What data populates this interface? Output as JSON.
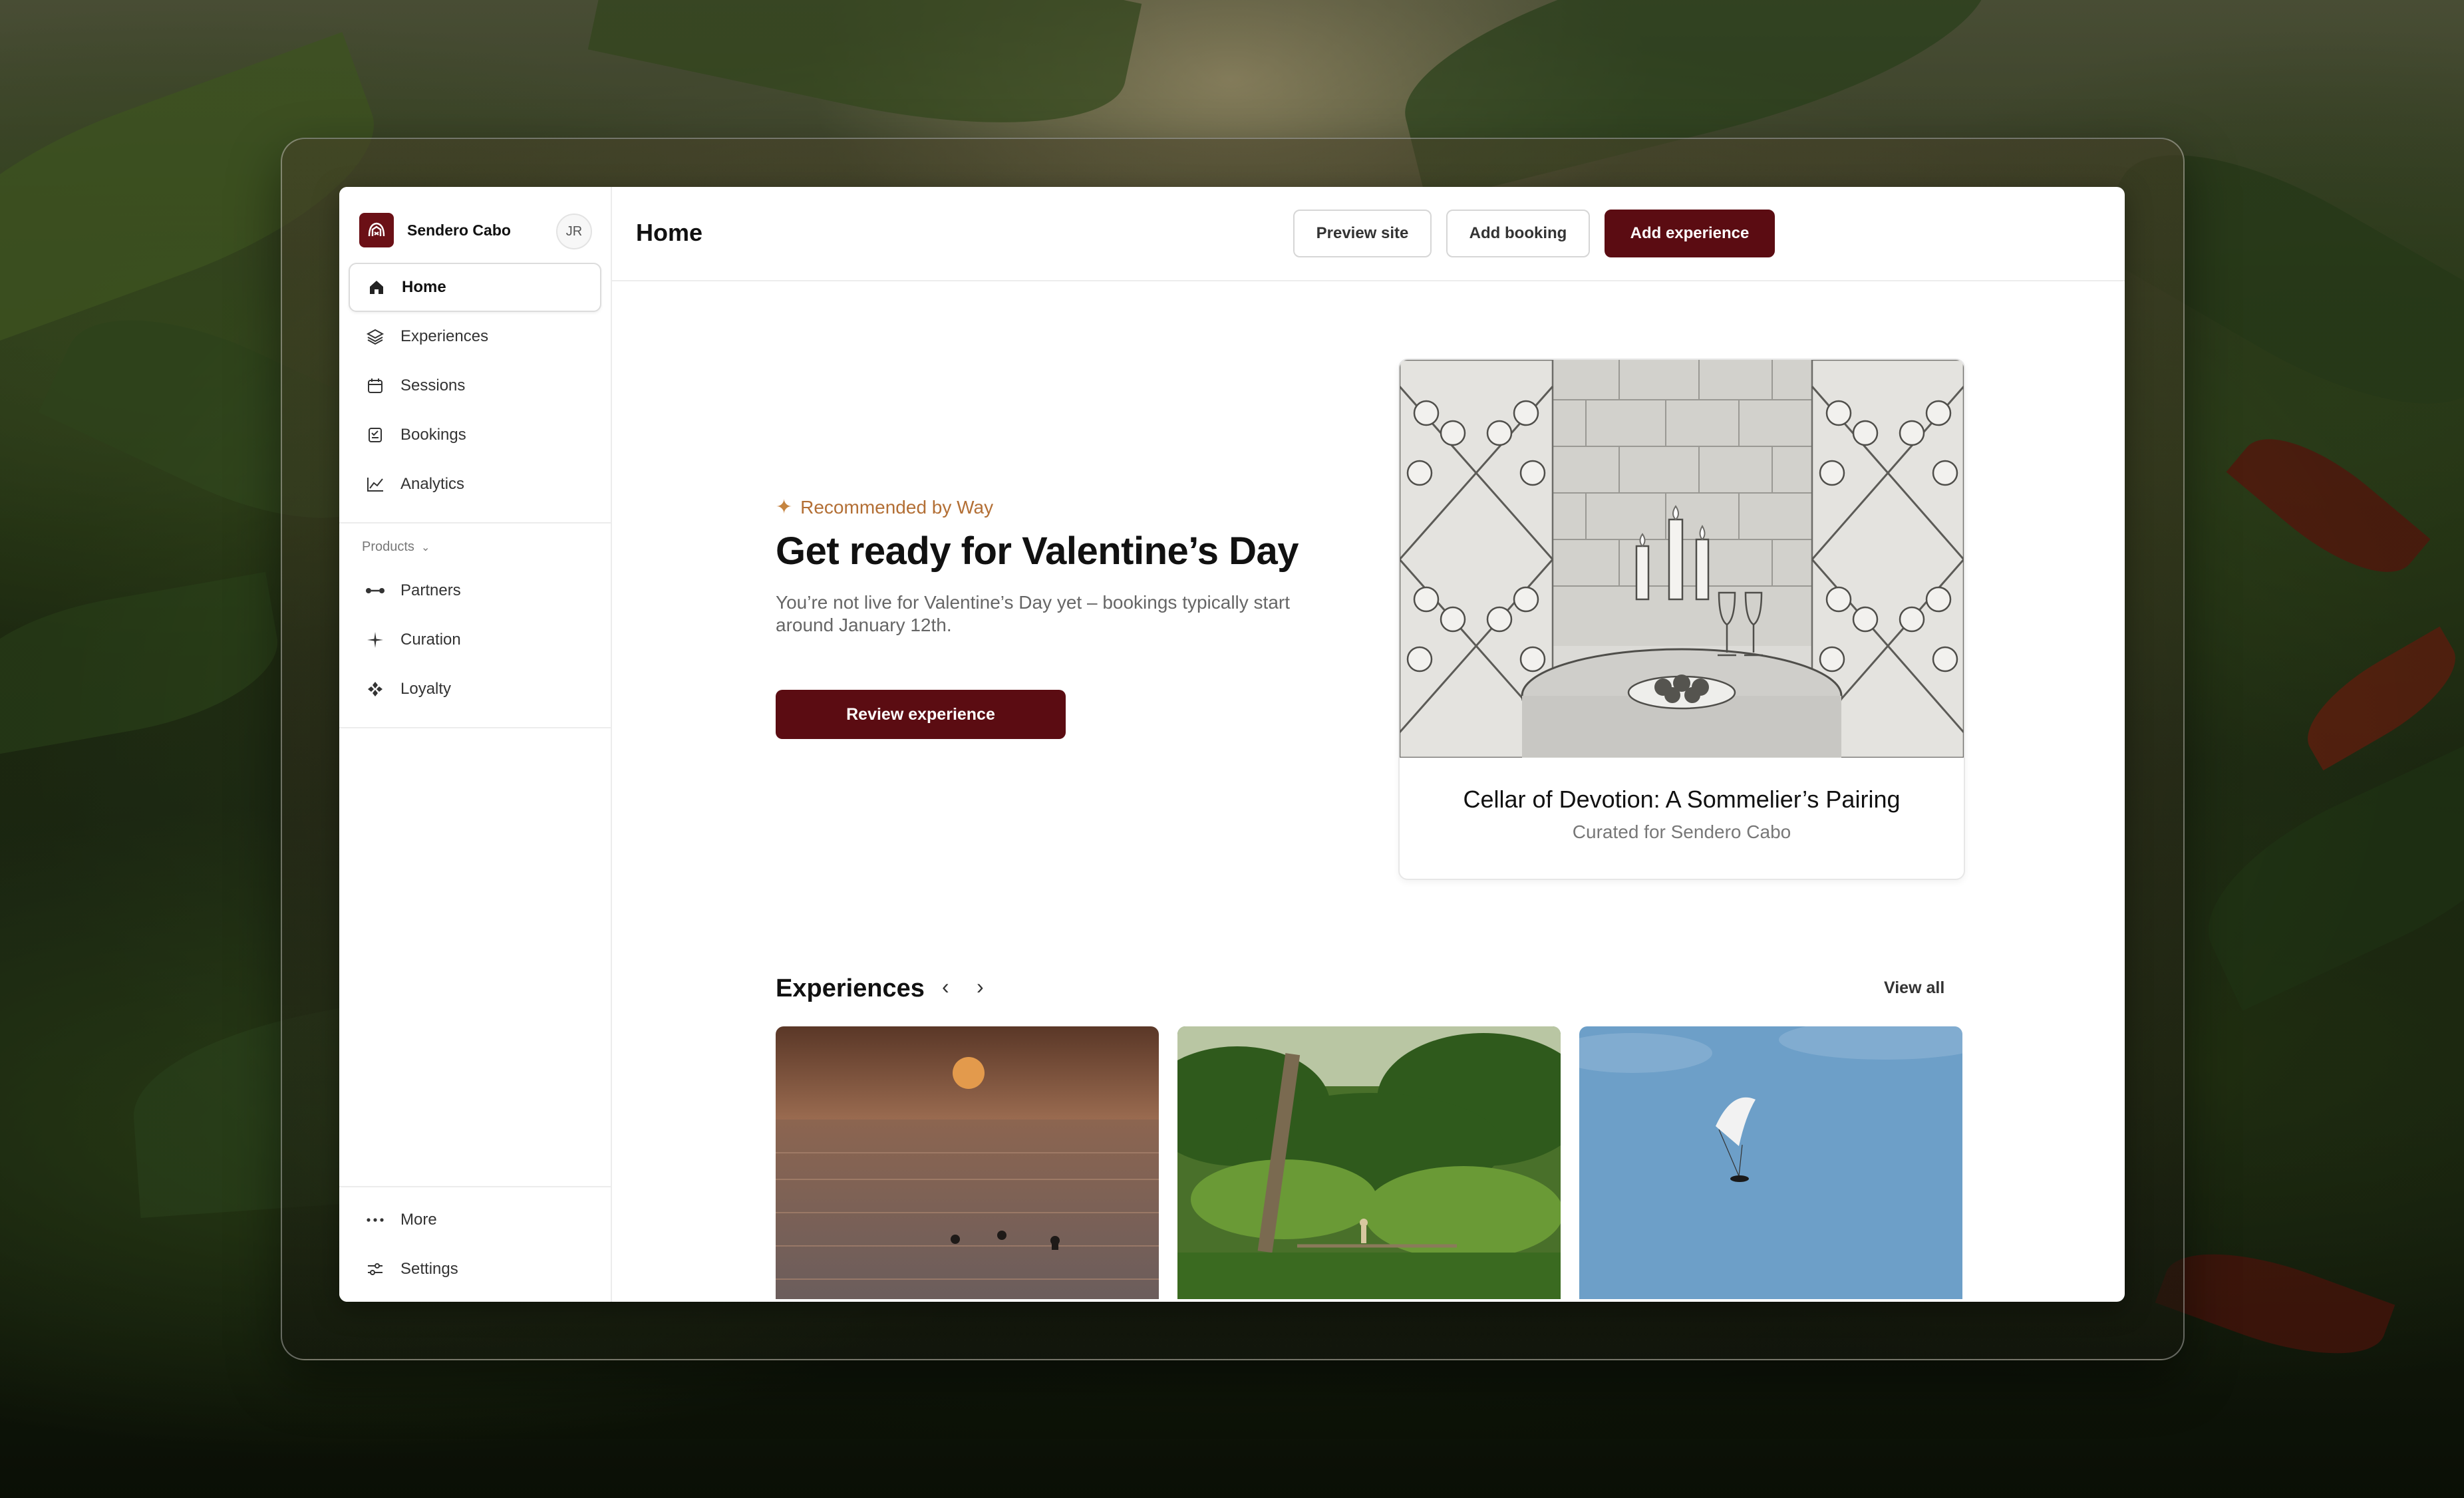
{
  "brand": {
    "name": "Sendero Cabo",
    "avatar_initials": "JR"
  },
  "sidebar": {
    "items": [
      {
        "label": "Home",
        "icon": "home-icon",
        "active": true
      },
      {
        "label": "Experiences",
        "icon": "layers-icon"
      },
      {
        "label": "Sessions",
        "icon": "calendar-icon"
      },
      {
        "label": "Bookings",
        "icon": "bookings-icon"
      },
      {
        "label": "Analytics",
        "icon": "chart-line-icon"
      }
    ],
    "section_label": "Products",
    "products": [
      {
        "label": "Partners",
        "icon": "partners-icon"
      },
      {
        "label": "Curation",
        "icon": "sparkle-icon"
      },
      {
        "label": "Loyalty",
        "icon": "loyalty-icon"
      }
    ],
    "footer": [
      {
        "label": "More",
        "icon": "more-icon"
      },
      {
        "label": "Settings",
        "icon": "sliders-icon"
      }
    ]
  },
  "header": {
    "title": "Home",
    "preview_label": "Preview site",
    "add_booking_label": "Add booking",
    "add_experience_label": "Add experience"
  },
  "hero": {
    "recommended": "Recommended by Way",
    "title": "Get ready for Valentine’s Day",
    "subtitle": "You’re not live for Valentine’s Day yet – bookings typically start around January 12th.",
    "cta": "Review experience"
  },
  "feature": {
    "title": "Cellar of Devotion: A Sommelier’s Pairing",
    "subtitle": "Curated for Sendero Cabo"
  },
  "experiences": {
    "title": "Experiences",
    "view_all": "View all"
  },
  "colors": {
    "accent": "#5b0c12",
    "brand": "#6b1016",
    "recommend": "#b36f35"
  }
}
